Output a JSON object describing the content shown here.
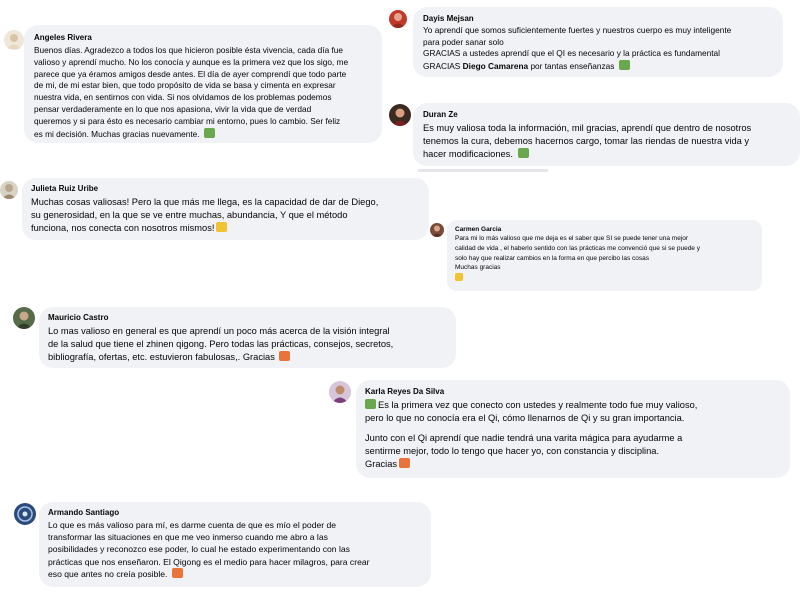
{
  "comments": [
    {
      "author": "Angeles Rivera",
      "text": "Buenos días. Agradezco a todos los que hicieron posible ésta vivencia, cada día fue\nvalioso y aprendí mucho. No los conocía y aunque es la primera vez que los sigo, me\nparece que ya éramos amigos desde antes. El día de ayer comprendí que todo parte\nde mi, de mi estar bien, que todo propósito de vida se basa y cimenta en expresar\nnuestra vida, en sentirnos con vida. Si nos olvidamos de los problemas podemos\npensar verdaderamente en lo que nos apasiona, vivir la vida que de verdad\nqueremos y si para ésto es necesario cambiar mi entorno, pues lo cambio. Ser feliz\nes mi decisión. Muchas gracias nuevamente.",
      "emoji": "landscape-emoji"
    },
    {
      "author": "Dayis Mejsan",
      "text_1": "Yo aprendí que somos suficientemente fuertes y nuestros cuerpo es muy inteligente\npara poder sanar solo\nGRACIAS a ustedes aprendí que el QI es necesario y la práctica es fundamental\nGRACIAS ",
      "highlight": "Diego Camarena",
      "text_2": " por tantas enseñanzas",
      "emoji": "landscape-emoji"
    },
    {
      "author": "Duran Ze",
      "text": "Es muy valiosa toda la información, mil gracias, aprendí que dentro de nosotros\ntenemos la cura, debemos hacernos cargo, tomar las riendas de nuestra vida y\nhacer modificaciones.",
      "emoji": "landscape-emoji"
    },
    {
      "author": "Julieta Ruiz Uribe",
      "text": "Muchas cosas valiosas! Pero la que más me llega, es la capacidad de dar de Diego,\nsu generosidad, en la que se ve entre muchas, abundancia, Y que el método\nfunciona, nos conecta con nosotros mismos!",
      "emoji": "pray-emoji"
    },
    {
      "author": "Carmen Garcia",
      "text": "Para mi lo más valioso que me deja es el saber que SI se puede tener una mejor\ncalidad de vida , el haberlo sentido con las prácticas me convenció que si se puede y\nsolo hay que realizar cambios en la forma en que percibo las cosas\nMuchas gracias",
      "emoji": "pray-emoji"
    },
    {
      "author": "Mauricio Castro",
      "text": "Lo mas valioso en general es que aprendí un poco más acerca de la visión integral\nde la salud que tiene el zhinen qigong. Pero todas las prácticas, consejos, secretos,\nbibliografía, ofertas, etc. estuvieron fabulosas,. Gracias",
      "emoji": "sunset-emoji"
    },
    {
      "author": "Karla Reyes Da Silva",
      "text_1": "Es la primera vez que conecto con ustedes y realmente todo fue muy valioso,\npero lo que no conocía era el Qi, cómo llenarnos de Qi y su gran importancia.",
      "text_2": "Junto con el Qi aprendí que nadie tendrá una varita mágica para ayudarme a\nsentirme mejor, todo lo tengo que hacer yo, con constancia y disciplina.\nGracias",
      "emoji_lead": "landscape-emoji",
      "emoji": "sunset-emoji"
    },
    {
      "author": "Armando Santiago",
      "text": "Lo que es más valioso para mí, es darme cuenta de que es mío el poder de\ntransformar las situaciones en que me veo inmerso cuando me abro a las\nposibilidades y reconozco ese poder, lo cual he estado experimentando con las\nprácticas que nos enseñaron. El Qigong es el medio para hacer milagros, para crear\neso que antes no creía posible.",
      "emoji": "sunset-emoji"
    }
  ],
  "colors": {
    "bubble": "#f0f2f5",
    "text": "#050505",
    "landscape_emoji": "#6aa84f",
    "pray_emoji": "#f1c232",
    "sunset_emoji": "#e8743b"
  }
}
